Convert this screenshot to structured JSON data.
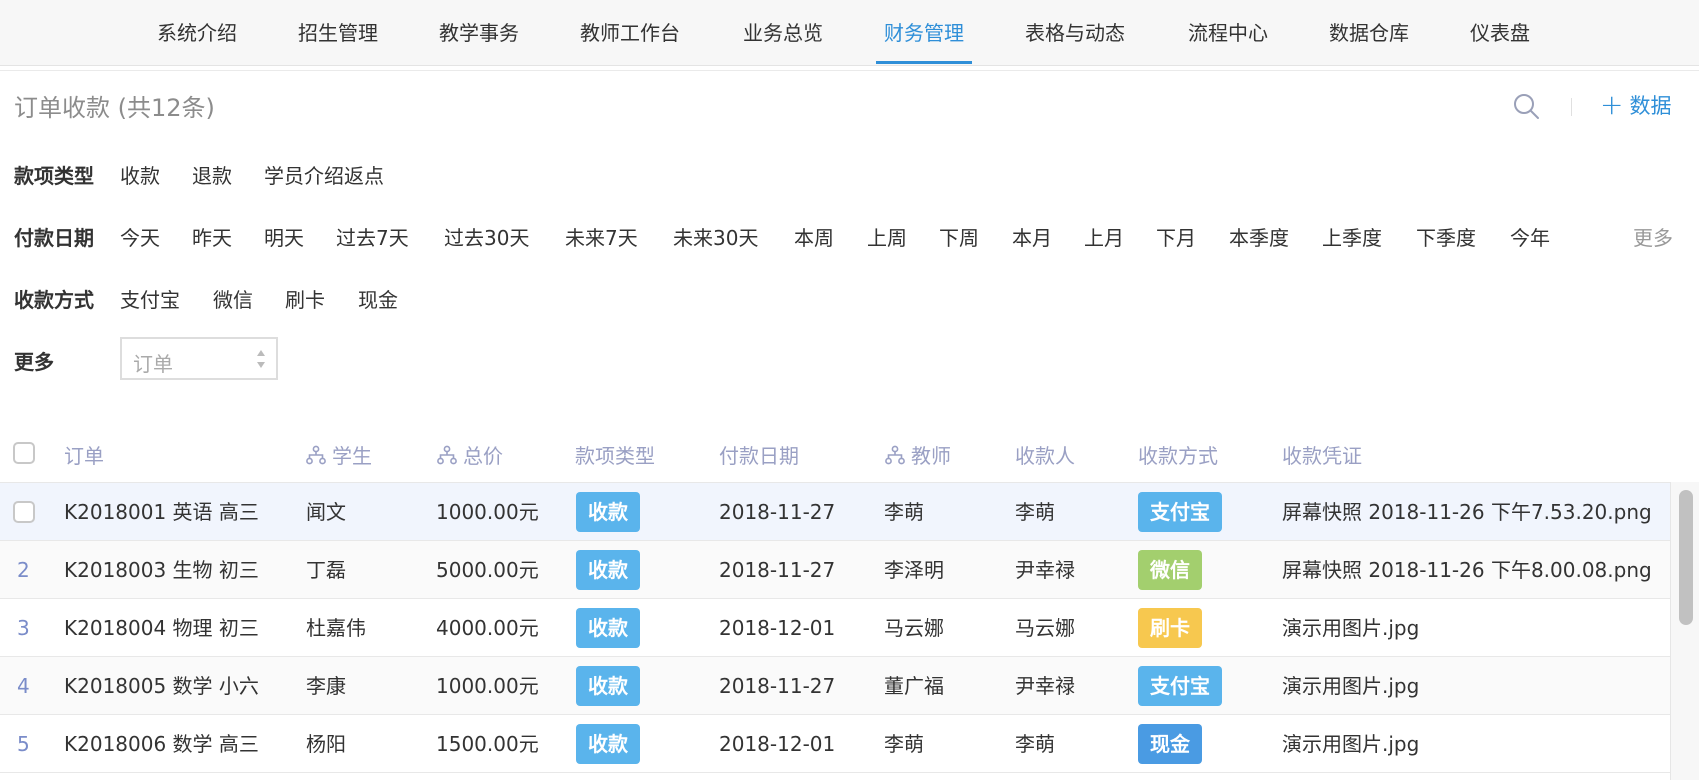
{
  "nav": {
    "tabs": [
      {
        "label": "系统介绍"
      },
      {
        "label": "招生管理"
      },
      {
        "label": "教学事务"
      },
      {
        "label": "教师工作台"
      },
      {
        "label": "业务总览"
      },
      {
        "label": "财务管理",
        "active": true
      },
      {
        "label": "表格与动态"
      },
      {
        "label": "流程中心"
      },
      {
        "label": "数据仓库"
      },
      {
        "label": "仪表盘"
      }
    ]
  },
  "header": {
    "title": "订单收款 (共12条)",
    "add_label": "数据",
    "search_icon": "search-icon",
    "add_icon": "plus-icon"
  },
  "filters": {
    "type": {
      "label": "款项类型",
      "options": [
        "收款",
        "退款",
        "学员介绍返点"
      ]
    },
    "date": {
      "label": "付款日期",
      "options": [
        "今天",
        "昨天",
        "明天",
        "过去7天",
        "过去30天",
        "未来7天",
        "未来30天",
        "本周",
        "上周",
        "下周",
        "本月",
        "上月",
        "下月",
        "本季度",
        "上季度",
        "下季度",
        "今年"
      ],
      "more": "更多"
    },
    "method": {
      "label": "收款方式",
      "options": [
        "支付宝",
        "微信",
        "刷卡",
        "现金"
      ]
    },
    "more": {
      "label": "更多",
      "select_value": "订单"
    }
  },
  "table": {
    "columns": [
      "订单",
      "学生",
      "总价",
      "款项类型",
      "付款日期",
      "教师",
      "收款人",
      "收款方式",
      "收款凭证"
    ],
    "rows": [
      {
        "index": "",
        "order": "K2018001 英语 高三",
        "student": "闻文",
        "total": "1000.00元",
        "type": "收款",
        "date": "2018-11-27",
        "teacher": "李萌",
        "payee": "李萌",
        "method": "支付宝",
        "voucher": "屏幕快照 2018-11-26 下午7.53.20.png"
      },
      {
        "index": "2",
        "order": "K2018003 生物 初三",
        "student": "丁磊",
        "total": "5000.00元",
        "type": "收款",
        "date": "2018-11-27",
        "teacher": "李泽明",
        "payee": "尹幸禄",
        "method": "微信",
        "voucher": "屏幕快照 2018-11-26 下午8.00.08.png"
      },
      {
        "index": "3",
        "order": "K2018004 物理 初三",
        "student": "杜嘉伟",
        "total": "4000.00元",
        "type": "收款",
        "date": "2018-12-01",
        "teacher": "马云娜",
        "payee": "马云娜",
        "method": "刷卡",
        "voucher": "演示用图片.jpg"
      },
      {
        "index": "4",
        "order": "K2018005 数学 小六",
        "student": "李康",
        "total": "1000.00元",
        "type": "收款",
        "date": "2018-11-27",
        "teacher": "董广福",
        "payee": "尹幸禄",
        "method": "支付宝",
        "voucher": "演示用图片.jpg"
      },
      {
        "index": "5",
        "order": "K2018006 数学 高三",
        "student": "杨阳",
        "total": "1500.00元",
        "type": "收款",
        "date": "2018-12-01",
        "teacher": "李萌",
        "payee": "李萌",
        "method": "现金",
        "voucher": "演示用图片.jpg"
      }
    ]
  },
  "colors": {
    "accent": "#2f8fd8",
    "badge_collect": "#5ab4ec",
    "method_alipay": "#5ab4ec",
    "method_wechat": "#a3cf6e",
    "method_card": "#f7c84f",
    "method_cash": "#4a9be3",
    "header_text": "#9aa0c4"
  }
}
